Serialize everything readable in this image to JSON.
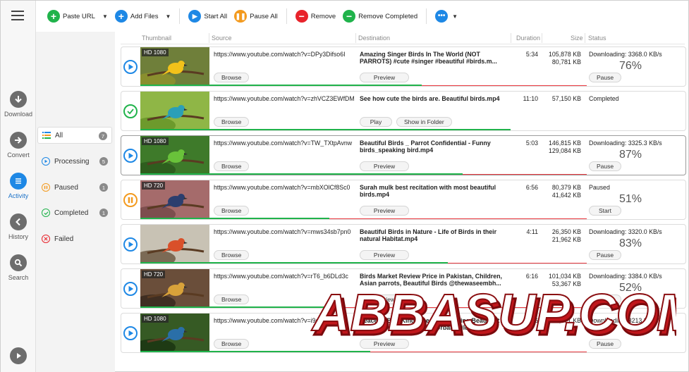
{
  "toolbar": {
    "paste_url": "Paste URL",
    "add_files": "Add Files",
    "start_all": "Start All",
    "pause_all": "Pause All",
    "remove": "Remove",
    "remove_completed": "Remove Completed"
  },
  "rail": {
    "download": "Download",
    "convert": "Convert",
    "activity": "Activity",
    "history": "History",
    "search": "Search"
  },
  "filters": [
    {
      "label": "All",
      "count": "7"
    },
    {
      "label": "Processing",
      "count": "5"
    },
    {
      "label": "Paused",
      "count": "1"
    },
    {
      "label": "Completed",
      "count": "1"
    },
    {
      "label": "Failed",
      "count": ""
    }
  ],
  "columns": {
    "thumbnail": "Thumbnail",
    "source": "Source",
    "destination": "Destination",
    "duration": "Duration",
    "size": "Size",
    "status": "Status"
  },
  "rows": [
    {
      "badge": "HD 1080",
      "source": "https://www.youtube.com/watch?v=DPy3Difso6I",
      "dest": "Amazing Singer Birds In The  World (NOT PARROTS) #cute #singer #beautiful #birds.m...",
      "duration": "5:34",
      "size1": "105,878 KB",
      "size2": "80,781 KB",
      "status": "Downloading: 3368.0 KB/s",
      "percent": "76%",
      "progress": 0.76,
      "b1": "Browse",
      "b2": "Preview",
      "b3": "Pause"
    },
    {
      "badge": "",
      "source": "https://www.youtube.com/watch?v=zhVCZ3EWfDM",
      "dest": "See how cute the birds are. Beautiful birds.mp4",
      "duration": "11:10",
      "size1": "57,150 KB",
      "size2": "",
      "status": "Completed",
      "percent": "",
      "progress": 1.0,
      "b1": "Browse",
      "b2": "Play",
      "b3": "Show in Folder"
    },
    {
      "badge": "HD 1080",
      "source": "https://www.youtube.com/watch?v=TW_TXtpAvnw",
      "dest": "Beautiful Birds _ Parrot Confidential - Funny birds_speaking bird.mp4",
      "duration": "5:03",
      "size1": "146,815 KB",
      "size2": "129,084 KB",
      "status": "Downloading: 3325.3 KB/s",
      "percent": "87%",
      "progress": 0.87,
      "b1": "Browse",
      "b2": "Preview",
      "b3": "Pause"
    },
    {
      "badge": "HD 720",
      "source": "https://www.youtube.com/watch?v=mbXOlCf8Sc0",
      "dest": "Surah mulk best recitation with most    beautiful birds.mp4",
      "duration": "6:56",
      "size1": "80,379 KB",
      "size2": "41,642 KB",
      "status": "Paused",
      "percent": "51%",
      "progress": 0.51,
      "b1": "Browse",
      "b2": "Preview",
      "b3": "Start"
    },
    {
      "badge": "",
      "source": "https://www.youtube.com/watch?v=mws34sb7pn0",
      "dest": "Beautiful Birds in Nature - Life of Birds in their natural Habitat.mp4",
      "duration": "4:11",
      "size1": "26,350 KB",
      "size2": "21,962 KB",
      "status": "Downloading: 3320.0 KB/s",
      "percent": "83%",
      "progress": 0.83,
      "b1": "Browse",
      "b2": "Preview",
      "b3": "Pause"
    },
    {
      "badge": "HD 720",
      "source": "https://www.youtube.com/watch?v=rT6_b6DLd3c",
      "dest": "Birds Market Review Price in Pakistan, Children, Asian parrots, Beautiful Birds @thewaseembh...",
      "duration": "6:16",
      "size1": "101,034 KB",
      "size2": "53,367 KB",
      "status": "Downloading: 3384.0 KB/s",
      "percent": "52%",
      "progress": 0.52,
      "b1": "Browse",
      "b2": "Preview",
      "b3": "Pause"
    },
    {
      "badge": "HD 1080",
      "source": "https://www.youtube.com/watch?v=i9eSK7biQ",
      "dest": "Peaceful Bird Kingfisher - A Stunning Beauty at Kannamangla Lake _ The Urban Wildlife.mp4",
      "duration": "4:56",
      "size1": "",
      "size2": "42,971 KB",
      "status": "Downloading: 3213.3 KB/s",
      "percent": "",
      "progress": 0.62,
      "b1": "Browse",
      "b2": "Preview",
      "b3": "Pause"
    }
  ],
  "watermark": "ABBASUP.COM"
}
